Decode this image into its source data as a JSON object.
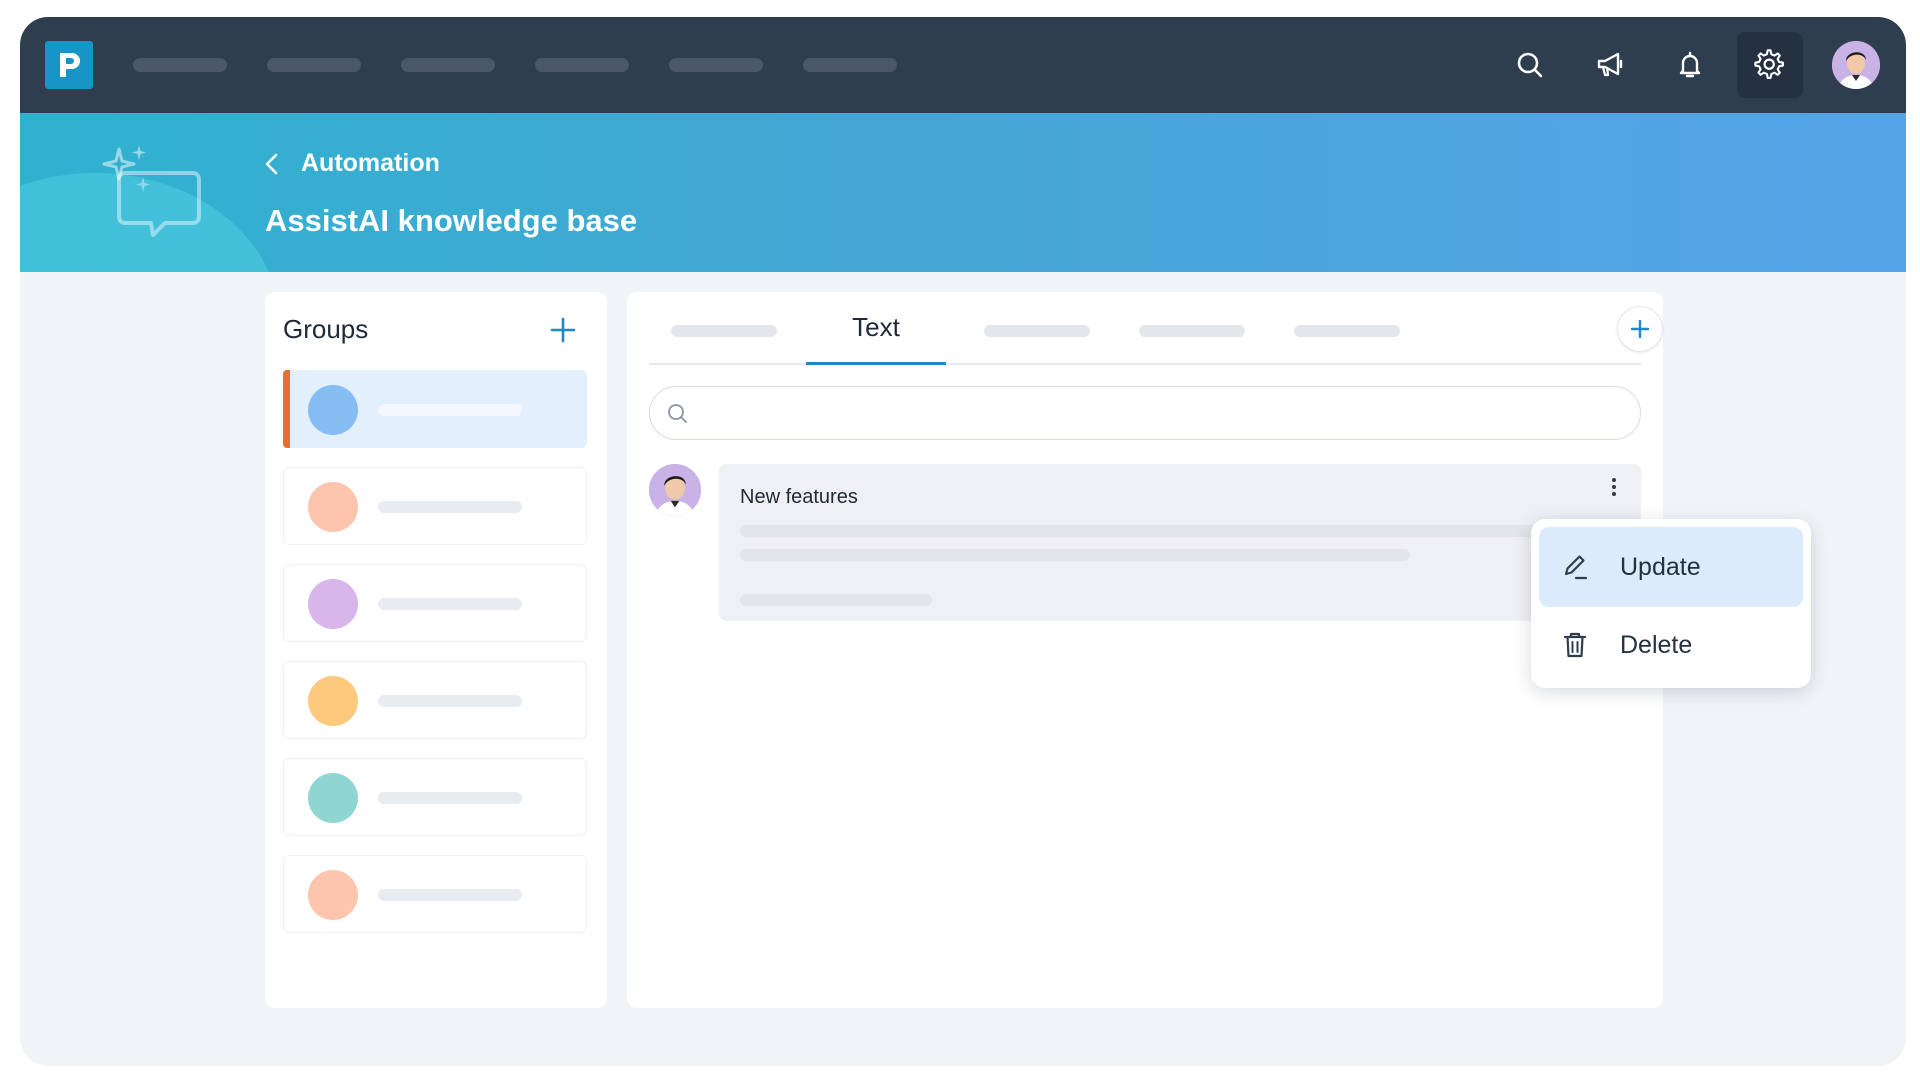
{
  "header": {
    "breadcrumb": "Automation",
    "title": "AssistAI knowledge base"
  },
  "groups": {
    "title": "Groups",
    "items": [
      {
        "color": "#86bdf3",
        "selected": true
      },
      {
        "color": "#fdc4ae"
      },
      {
        "color": "#d8b6ec"
      },
      {
        "color": "#fec97c"
      },
      {
        "color": "#8fd6d3"
      },
      {
        "color": "#fdc4ae"
      }
    ]
  },
  "tabs": {
    "active_label": "Text"
  },
  "entry": {
    "title": "New features"
  },
  "context_menu": {
    "update_label": "Update",
    "delete_label": "Delete"
  },
  "colors": {
    "nav": "#2f3e4f",
    "accent": "#1e88c9",
    "selected_group_marker": "#e8702f"
  }
}
